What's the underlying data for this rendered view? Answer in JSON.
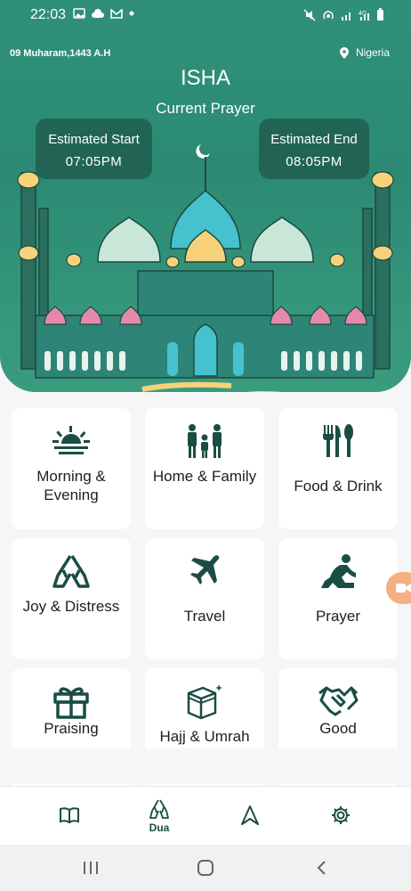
{
  "status_bar": {
    "time": "22:03",
    "left_icons": [
      "gallery-icon",
      "cloud-icon",
      "gmail-icon",
      "dot-icon"
    ],
    "right_icons": [
      "mute-icon",
      "hotspot-icon",
      "signal-icon",
      "4g-icon",
      "battery-icon"
    ]
  },
  "header": {
    "hijri_date": "09 Muharam,1443 A.H",
    "location": "Nigeria",
    "prayer_name": "ISHA",
    "prayer_subtitle": "Current Prayer",
    "start_label": "Estimated Start",
    "start_time": "07:05PM",
    "end_label": "Estimated End",
    "end_time": "08:05PM"
  },
  "categories": [
    {
      "label": "Morning & Evening",
      "icon": "sunrise-icon"
    },
    {
      "label": "Home & Family",
      "icon": "family-icon"
    },
    {
      "label": "Food & Drink",
      "icon": "utensils-icon"
    },
    {
      "label": "Joy & Distress",
      "icon": "praying-hands-icon"
    },
    {
      "label": "Travel",
      "icon": "airplane-icon"
    },
    {
      "label": "Prayer",
      "icon": "kneeling-person-icon"
    },
    {
      "label": "Praising",
      "icon": "gift-icon"
    },
    {
      "label": "Hajj & Umrah",
      "icon": "kaaba-icon"
    },
    {
      "label": "Good",
      "icon": "handshake-icon"
    }
  ],
  "bottom_nav": {
    "items": [
      {
        "icon": "book-icon",
        "label": ""
      },
      {
        "icon": "dua-hands-icon",
        "label": "Dua"
      },
      {
        "icon": "qibla-arrow-icon",
        "label": ""
      },
      {
        "icon": "gear-icon",
        "label": ""
      }
    ]
  },
  "colors": {
    "primary": "#2e8f78",
    "dark_teal": "#1a4d44",
    "accent_yellow": "#f7d27a",
    "accent_pink": "#e48aa8",
    "accent_cyan": "#46c2cf"
  }
}
